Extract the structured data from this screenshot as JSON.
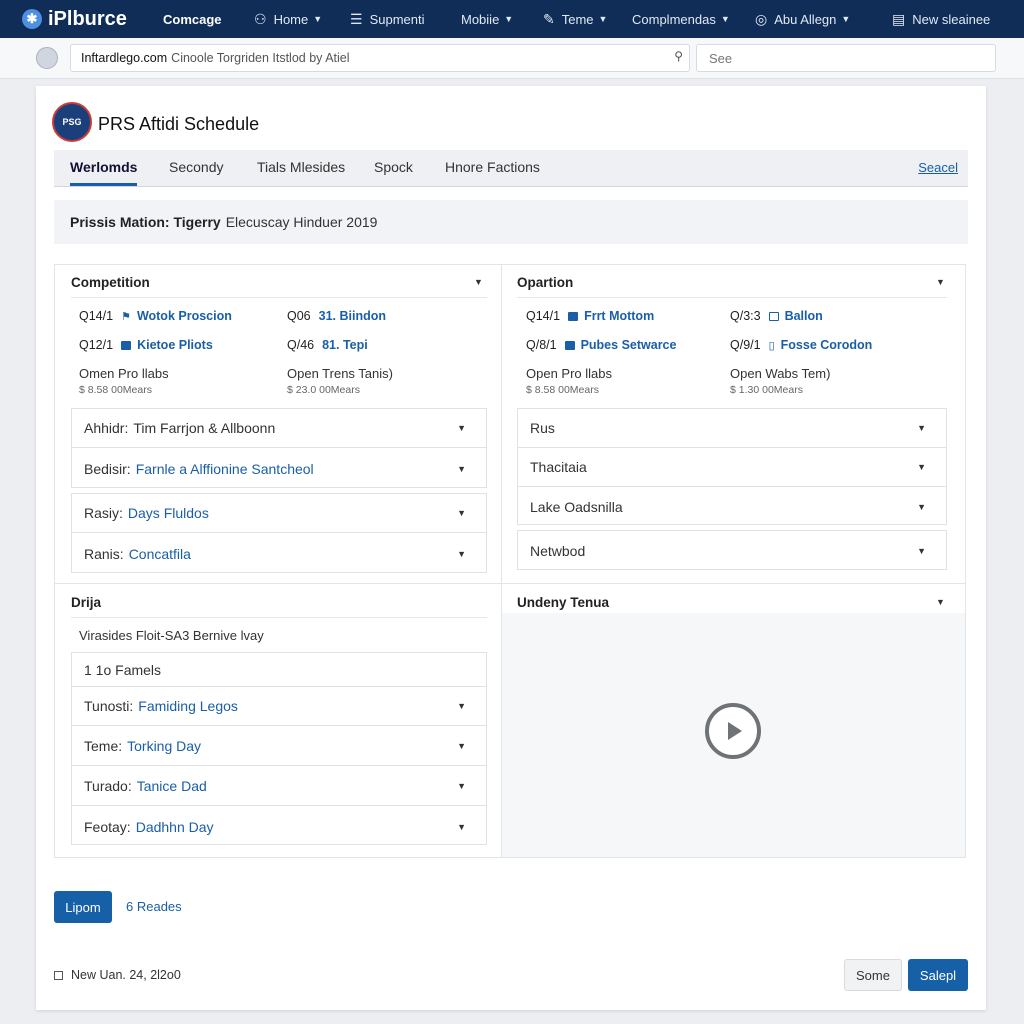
{
  "brand": {
    "name": "iPlburce"
  },
  "topnav": {
    "items": [
      {
        "label": "Comcage",
        "icon": "none"
      },
      {
        "label": "Home",
        "icon": "user-icon"
      },
      {
        "label": "Supmenti",
        "icon": "menu-icon"
      },
      {
        "label": "Mobiie",
        "icon": "none"
      },
      {
        "label": "Teme",
        "icon": "pen-icon"
      },
      {
        "label": "Complmendas",
        "icon": "none"
      },
      {
        "label": "Abu Allegn",
        "icon": "badge-icon"
      },
      {
        "label": "New sleainee",
        "icon": "document-icon"
      }
    ]
  },
  "addressbar": {
    "domain": "Inftardlego.com",
    "rest": "Cinoole Torgriden Itstlod by Atiel",
    "search_placeholder": "See"
  },
  "page": {
    "title": "PRS  Aftidi Schedule",
    "logo_text": "PSG"
  },
  "tabs": [
    {
      "label": "Werlomds",
      "active": true
    },
    {
      "label": "Secondy",
      "active": false
    },
    {
      "label": "Tials Mlesides",
      "active": false
    },
    {
      "label": "Spock",
      "active": false
    },
    {
      "label": "Hnore Factions",
      "active": false
    }
  ],
  "tab_search_label": "Seacel",
  "banner": {
    "bold": "Prissis Mation: Tigerry",
    "rest": "Elecuscay Hinduer 2019"
  },
  "competition": {
    "heading": "Competition",
    "rows": [
      {
        "code": "Q14/1",
        "icon": "flag-icon",
        "value": "Wotok Proscion"
      },
      {
        "code": "Q06",
        "icon": "none",
        "value": "31. Biindon"
      },
      {
        "code": "Q12/1",
        "icon": "square-icon",
        "value": "Kietoe Pliots"
      },
      {
        "code": "Q/46",
        "icon": "none",
        "value": "81. Tepi"
      }
    ],
    "sub_left_label": "Omen Pro llabs",
    "sub_left_price": "$ 8.58 00Mears",
    "sub_right_label": "Open Trens Tanis)",
    "sub_right_price": "$ 23.0 00Mears",
    "group1": [
      {
        "label": "Ahhidr:",
        "value": "Tim Farrjon & Allboonn",
        "value_plain": true
      },
      {
        "label": "Bedisir:",
        "value": "Farnle a Alffionine Santcheol"
      }
    ],
    "group2": [
      {
        "label": "Rasiy:",
        "value": "Days Fluldos"
      },
      {
        "label": "Ranis:",
        "value": "Concatfila"
      }
    ]
  },
  "opartion": {
    "heading": "Opartion",
    "rows": [
      {
        "code": "Q14/1",
        "icon": "square-icon",
        "value": "Frrt Mottom"
      },
      {
        "code": "Q/3:3",
        "icon": "square-outline-icon",
        "value": "Ballon"
      },
      {
        "code": "Q/8/1",
        "icon": "square-icon",
        "value": "Pubes Setwarce"
      },
      {
        "code": "Q/9/1",
        "icon": "doc-icon",
        "value": "Fosse Corodon"
      }
    ],
    "sub_left_label": "Open Pro llabs",
    "sub_left_price": "$ 8.58 00Mears",
    "sub_right_label": "Open Wabs Tem)",
    "sub_right_price": "$ 1.30 00Mears",
    "group1": [
      "Rus",
      "Thacitaia",
      "Lake Oadsnilla"
    ],
    "group2": [
      "Netwbod"
    ]
  },
  "drija": {
    "heading": "Drija",
    "tags": "Virasides   Floit-SA3   Bernive lvay",
    "count": "1 1o Famels",
    "rows": [
      {
        "label": "Tunosti:",
        "value": "Famiding Legos"
      },
      {
        "label": "Teme:",
        "value": "Torking Day"
      },
      {
        "label": "Turado:",
        "value": "Tanice Dad"
      },
      {
        "label": "Feotay:",
        "value": "Dadhhn Day"
      }
    ]
  },
  "video": {
    "heading": "Undeny Tenua"
  },
  "actions": {
    "primary_label": "Lipom",
    "link_label": "6 Reades",
    "date": "New Uan. 24, 2l2o0",
    "secondary_label": "Some",
    "submit_label": "Salepl"
  },
  "colors": {
    "nav_bg": "#0f2d57",
    "accent": "#1a5ea8",
    "primary_button": "#1560a6"
  }
}
